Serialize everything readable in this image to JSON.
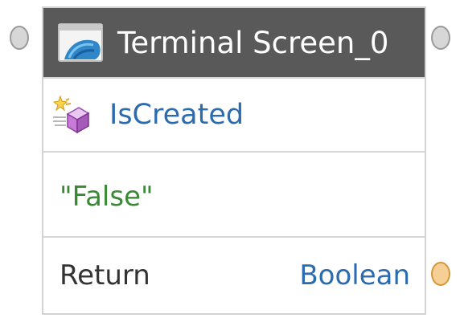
{
  "node": {
    "title": "Terminal Screen_0",
    "title_icon": "terminal-screen-icon",
    "property": {
      "label": "IsCreated",
      "icon": "property-get-icon"
    },
    "value": "\"False\"",
    "return": {
      "label": "Return",
      "type": "Boolean"
    }
  },
  "colors": {
    "header_background": "#595959",
    "property_text": "#2b6bb0",
    "value_text": "#3a8a35",
    "return_port": "#f6cf95",
    "flow_port": "#d7d7d7"
  }
}
